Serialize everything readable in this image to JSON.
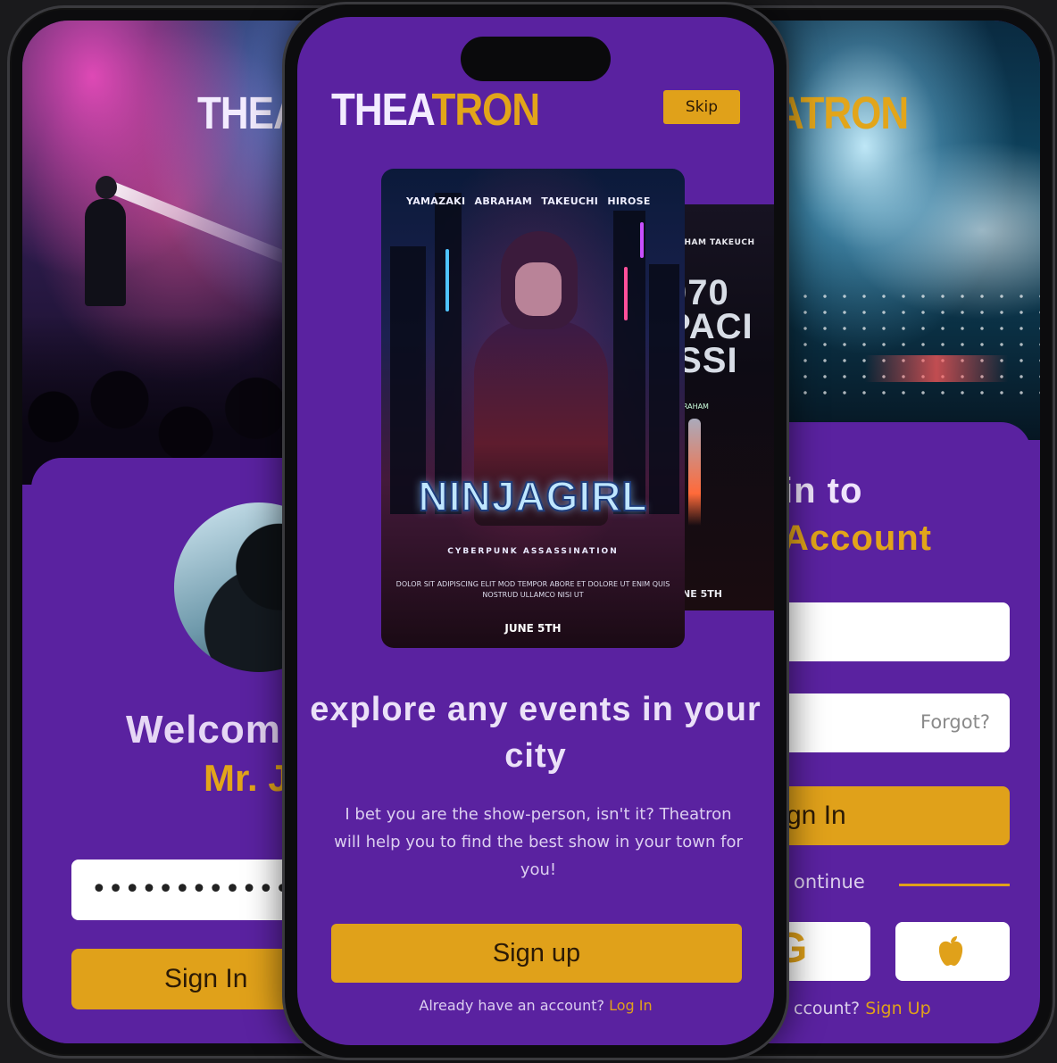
{
  "brand": {
    "logo_white": "THEA",
    "logo_yellow": "TRON",
    "logo_left_visible": "THEAT",
    "logo_right_visible": "ATRON"
  },
  "colors": {
    "purple": "#5a22a0",
    "accent": "#e0a11a",
    "text_light": "#ebe1f8"
  },
  "left_screen": {
    "welcome": "Welcom",
    "name": "Mr. J",
    "password_masked": "•••••••••••••••",
    "signin_label": "Sign In"
  },
  "center_screen": {
    "skip_label": "Skip",
    "poster_main": {
      "names": "YAMAZAKI ABRAHAM TAKEUCHI HIROSE",
      "title": "NINJAGIRL",
      "subtitle": "CYBERPUNK ASSASSINATION",
      "fine_print": "DOLOR SIT ADIPISCING ELIT MOD TEMPOR ABORE ET DOLORE UT ENIM QUIS NOSTRUD ULLAMCO NISI UT",
      "date": "JUNE 5TH"
    },
    "poster_side": {
      "names": "AHAM TAKEUCH",
      "big_text": "070\nPACI\nISSI",
      "by": "I ABRAHAM",
      "date": "JUNE 5TH"
    },
    "headline": "explore any events in your city",
    "description": "I bet you are the show-person, isn't it? Theatron will help you to find the best show in your town for you!",
    "signup_label": "Sign up",
    "already_text": "Already have an account?",
    "login_link": "Log In"
  },
  "right_screen": {
    "title_line1": "in to",
    "title_line2": "Account",
    "forgot_label": "Forgot?",
    "signin_label": "gn In",
    "continue_text": "ontinue",
    "google_icon": "G",
    "apple_icon": "apple-icon",
    "account_text": "ccount?",
    "signup_link": "Sign Up"
  }
}
